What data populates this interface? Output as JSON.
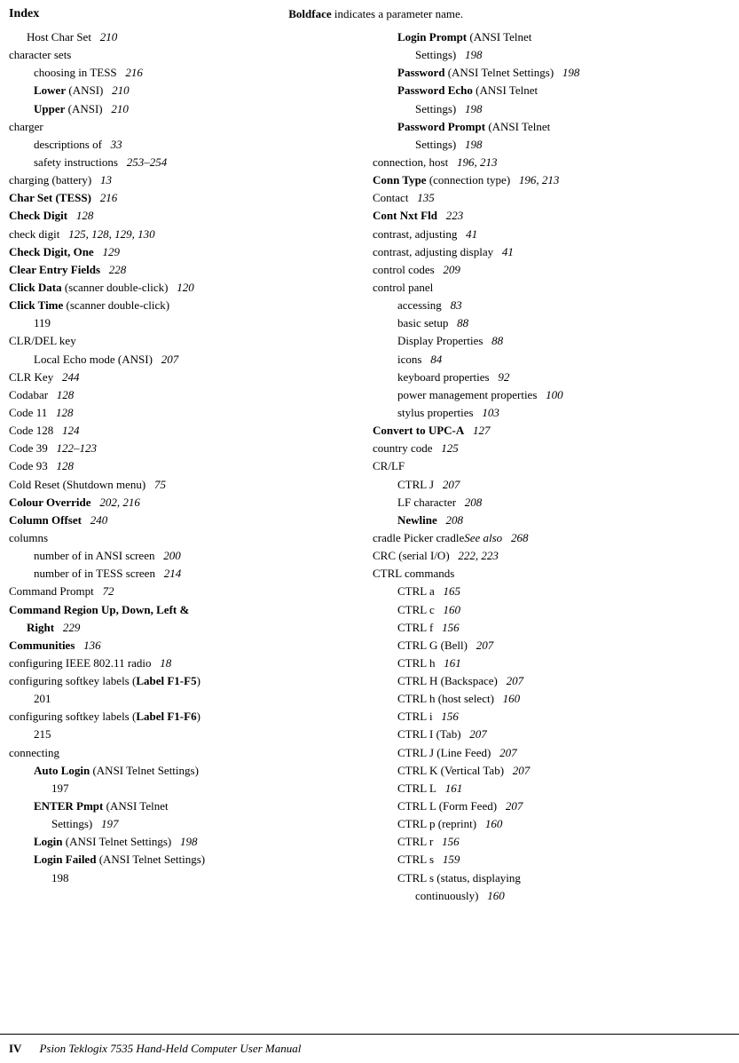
{
  "header": {
    "index_label": "Index",
    "tagline_part1": "Boldface",
    "tagline_part2": " indicates a parameter name."
  },
  "footer": {
    "page_label": "IV",
    "book_title": "Psion Teklogix 7535 Hand-Held Computer User Manual"
  },
  "left_column": [
    {
      "indent": 1,
      "text": "Host Char Set",
      "bold": false,
      "page": "210"
    },
    {
      "indent": 0,
      "text": "character sets",
      "bold": false,
      "page": ""
    },
    {
      "indent": 2,
      "text": "choosing in TESS",
      "bold": false,
      "page": "216"
    },
    {
      "indent": 2,
      "text": "Lower",
      "bold": true,
      "after": " (ANSI)",
      "page": "210"
    },
    {
      "indent": 2,
      "text": "Upper",
      "bold": true,
      "after": " (ANSI)",
      "page": "210"
    },
    {
      "indent": 0,
      "text": "charger",
      "bold": false,
      "page": ""
    },
    {
      "indent": 2,
      "text": "descriptions of",
      "bold": false,
      "page": "33"
    },
    {
      "indent": 2,
      "text": "safety instructions",
      "bold": false,
      "page": "253–254"
    },
    {
      "indent": 0,
      "text": "charging (battery)",
      "bold": false,
      "page": "13"
    },
    {
      "indent": 0,
      "text": "Char Set (TESS)",
      "bold": true,
      "page": "216"
    },
    {
      "indent": 0,
      "text": "Check Digit",
      "bold": true,
      "page": "128"
    },
    {
      "indent": 0,
      "text": "check digit",
      "bold": false,
      "page": "125, 128, 129, 130"
    },
    {
      "indent": 0,
      "text": "Check Digit, One",
      "bold": true,
      "page": "129"
    },
    {
      "indent": 0,
      "text": "Clear Entry Fields",
      "bold": true,
      "page": "228"
    },
    {
      "indent": 0,
      "text": "Click Data",
      "bold": true,
      "after": " (scanner double-click)",
      "page": "120"
    },
    {
      "indent": 0,
      "text": "Click Time",
      "bold": true,
      "after": " (scanner double-click)",
      "page": ""
    },
    {
      "indent": 2,
      "text": "119",
      "bold": false,
      "page": ""
    },
    {
      "indent": 0,
      "text": "CLR/DEL key",
      "bold": false,
      "page": ""
    },
    {
      "indent": 2,
      "text": "Local Echo mode (ANSI)",
      "bold": false,
      "page": "207"
    },
    {
      "indent": 0,
      "text": "CLR Key",
      "bold": false,
      "page": "244"
    },
    {
      "indent": 0,
      "text": "Codabar",
      "bold": false,
      "page": "128"
    },
    {
      "indent": 0,
      "text": "Code 11",
      "bold": false,
      "page": "128"
    },
    {
      "indent": 0,
      "text": "Code 128",
      "bold": false,
      "page": "124"
    },
    {
      "indent": 0,
      "text": "Code 39",
      "bold": false,
      "page": "122–123"
    },
    {
      "indent": 0,
      "text": "Code 93",
      "bold": false,
      "page": "128"
    },
    {
      "indent": 0,
      "text": "Cold Reset (Shutdown menu)",
      "bold": false,
      "page": "75"
    },
    {
      "indent": 0,
      "text": "Colour Override",
      "bold": true,
      "page": "202, 216"
    },
    {
      "indent": 0,
      "text": "Column Offset",
      "bold": true,
      "page": "240"
    },
    {
      "indent": 0,
      "text": "columns",
      "bold": false,
      "page": ""
    },
    {
      "indent": 2,
      "text": "number of in ANSI screen",
      "bold": false,
      "page": "200"
    },
    {
      "indent": 2,
      "text": "number of in TESS screen",
      "bold": false,
      "page": "214"
    },
    {
      "indent": 0,
      "text": "Command Prompt",
      "bold": false,
      "page": "72"
    },
    {
      "indent": 0,
      "text": "Command Region Up, Down, Left &",
      "bold": true,
      "page": ""
    },
    {
      "indent": 1,
      "text": "Right",
      "bold": true,
      "page": "229"
    },
    {
      "indent": 0,
      "text": "Communities",
      "bold": true,
      "page": "136"
    },
    {
      "indent": 0,
      "text": "configuring IEEE 802.11 radio",
      "bold": false,
      "page": "18"
    },
    {
      "indent": 0,
      "text": "configuring softkey labels (",
      "bold": false,
      "after_bold": "Label F1-F5",
      "after": ")",
      "page": ""
    },
    {
      "indent": 2,
      "text": "201",
      "bold": false,
      "page": ""
    },
    {
      "indent": 0,
      "text": "configuring softkey labels (",
      "bold": false,
      "after_bold": "Label F1-F6",
      "after": ")",
      "page": ""
    },
    {
      "indent": 2,
      "text": "215",
      "bold": false,
      "page": ""
    },
    {
      "indent": 0,
      "text": "connecting",
      "bold": false,
      "page": ""
    },
    {
      "indent": 2,
      "text": "Auto Login",
      "bold": true,
      "after": " (ANSI Telnet Settings)",
      "page": ""
    },
    {
      "indent": 3,
      "text": "197",
      "bold": false,
      "page": ""
    },
    {
      "indent": 2,
      "text": "ENTER Pmpt",
      "bold": true,
      "after": " (ANSI Telnet",
      "page": ""
    },
    {
      "indent": 3,
      "text": "Settings)",
      "bold": false,
      "page": "197"
    },
    {
      "indent": 2,
      "text": "Login",
      "bold": true,
      "after": " (ANSI Telnet Settings)",
      "page": "198"
    },
    {
      "indent": 2,
      "text": "Login Failed",
      "bold": true,
      "after": " (ANSI Telnet Settings)",
      "page": ""
    },
    {
      "indent": 3,
      "text": "198",
      "bold": false,
      "page": ""
    }
  ],
  "right_column": [
    {
      "indent": 2,
      "text": "Login Prompt",
      "bold": true,
      "after": " (ANSI Telnet",
      "page": ""
    },
    {
      "indent": 3,
      "text": "Settings)",
      "bold": false,
      "page": "198"
    },
    {
      "indent": 2,
      "text": "Password",
      "bold": true,
      "after": " (ANSI Telnet Settings)",
      "page": "198"
    },
    {
      "indent": 2,
      "text": "Password Echo",
      "bold": true,
      "after": " (ANSI Telnet",
      "page": ""
    },
    {
      "indent": 3,
      "text": "Settings)",
      "bold": false,
      "page": "198"
    },
    {
      "indent": 2,
      "text": "Password Prompt",
      "bold": true,
      "after": " (ANSI Telnet",
      "page": ""
    },
    {
      "indent": 3,
      "text": "Settings)",
      "bold": false,
      "page": "198"
    },
    {
      "indent": 0,
      "text": "connection, host",
      "bold": false,
      "page": "196, 213"
    },
    {
      "indent": 0,
      "text": "Conn Type",
      "bold": true,
      "after": " (connection type)",
      "page": "196, 213"
    },
    {
      "indent": 0,
      "text": "Contact",
      "bold": false,
      "page": "135"
    },
    {
      "indent": 0,
      "text": "Cont Nxt Fld",
      "bold": true,
      "page": "223"
    },
    {
      "indent": 0,
      "text": "contrast, adjusting",
      "bold": false,
      "page": "41"
    },
    {
      "indent": 0,
      "text": "contrast, adjusting display",
      "bold": false,
      "page": "41"
    },
    {
      "indent": 0,
      "text": "control codes",
      "bold": false,
      "page": "209"
    },
    {
      "indent": 0,
      "text": "control panel",
      "bold": false,
      "page": ""
    },
    {
      "indent": 2,
      "text": "accessing",
      "bold": false,
      "page": "83"
    },
    {
      "indent": 2,
      "text": "basic setup",
      "bold": false,
      "page": "88"
    },
    {
      "indent": 2,
      "text": "Display Properties",
      "bold": false,
      "page": "88"
    },
    {
      "indent": 2,
      "text": "icons",
      "bold": false,
      "page": "84"
    },
    {
      "indent": 2,
      "text": "keyboard properties",
      "bold": false,
      "page": "92"
    },
    {
      "indent": 2,
      "text": "power management properties",
      "bold": false,
      "page": "100"
    },
    {
      "indent": 2,
      "text": "stylus properties",
      "bold": false,
      "page": "103"
    },
    {
      "indent": 0,
      "text": "Convert to UPC-A",
      "bold": true,
      "page": "127"
    },
    {
      "indent": 0,
      "text": "country code",
      "bold": false,
      "page": "125"
    },
    {
      "indent": 0,
      "text": "CR/LF",
      "bold": false,
      "page": ""
    },
    {
      "indent": 2,
      "text": "CTRL J",
      "bold": false,
      "page": "207"
    },
    {
      "indent": 2,
      "text": "LF character",
      "bold": false,
      "page": "208"
    },
    {
      "indent": 2,
      "text": "Newline",
      "bold": true,
      "page": "208"
    },
    {
      "indent": 0,
      "text": "cradle ",
      "bold": false,
      "italic_after": "See also",
      "after": " Picker cradle",
      "page": "268"
    },
    {
      "indent": 0,
      "text": "CRC (serial I/O)",
      "bold": false,
      "page": "222, 223"
    },
    {
      "indent": 0,
      "text": "CTRL commands",
      "bold": false,
      "page": ""
    },
    {
      "indent": 2,
      "text": "CTRL a",
      "bold": false,
      "page": "165"
    },
    {
      "indent": 2,
      "text": "CTRL c",
      "bold": false,
      "page": "160"
    },
    {
      "indent": 2,
      "text": "CTRL f",
      "bold": false,
      "page": "156"
    },
    {
      "indent": 2,
      "text": "CTRL G (Bell)",
      "bold": false,
      "page": "207"
    },
    {
      "indent": 2,
      "text": "CTRL h",
      "bold": false,
      "page": "161"
    },
    {
      "indent": 2,
      "text": "CTRL H (Backspace)",
      "bold": false,
      "page": "207"
    },
    {
      "indent": 2,
      "text": "CTRL h (host select)",
      "bold": false,
      "page": "160"
    },
    {
      "indent": 2,
      "text": "CTRL i",
      "bold": false,
      "page": "156"
    },
    {
      "indent": 2,
      "text": "CTRL I (Tab)",
      "bold": false,
      "page": "207"
    },
    {
      "indent": 2,
      "text": "CTRL J (Line Feed)",
      "bold": false,
      "page": "207"
    },
    {
      "indent": 2,
      "text": "CTRL K (Vertical Tab)",
      "bold": false,
      "page": "207"
    },
    {
      "indent": 2,
      "text": "CTRL L",
      "bold": false,
      "page": "161"
    },
    {
      "indent": 2,
      "text": "CTRL L (Form Feed)",
      "bold": false,
      "page": "207"
    },
    {
      "indent": 2,
      "text": "CTRL p (reprint)",
      "bold": false,
      "page": "160"
    },
    {
      "indent": 2,
      "text": "CTRL r",
      "bold": false,
      "page": "156"
    },
    {
      "indent": 2,
      "text": "CTRL s",
      "bold": false,
      "page": "159"
    },
    {
      "indent": 2,
      "text": "CTRL s (status, displaying",
      "bold": false,
      "page": ""
    },
    {
      "indent": 3,
      "text": "continuously)",
      "bold": false,
      "page": "160"
    }
  ]
}
